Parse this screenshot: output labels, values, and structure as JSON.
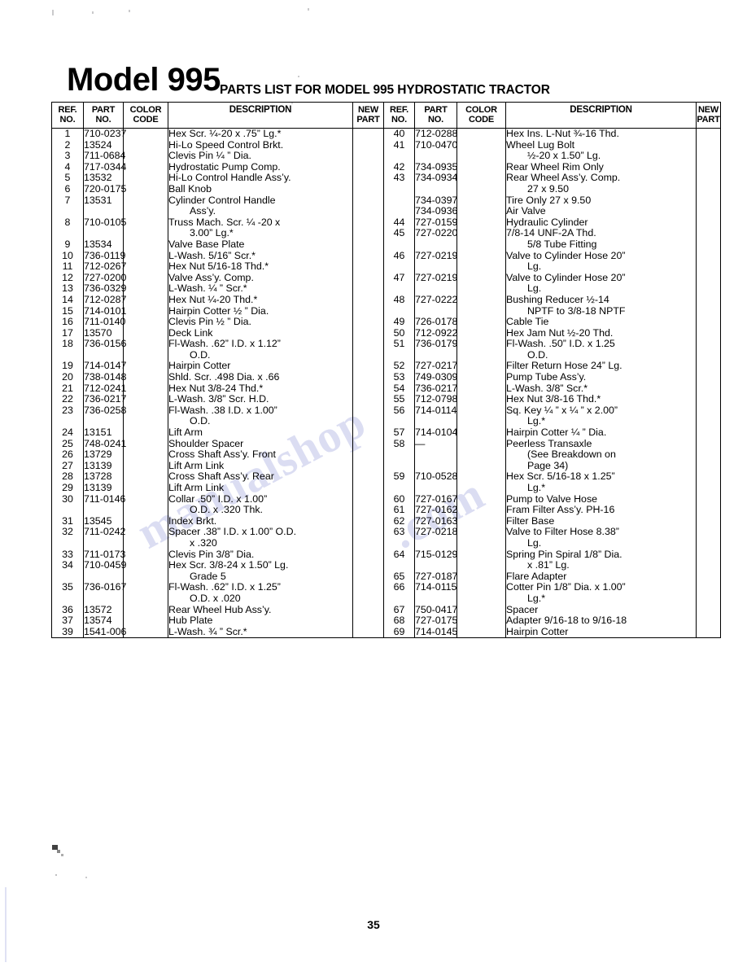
{
  "document": {
    "model_title": "Model 995",
    "parts_list_title": "PARTS LIST FOR MODEL 995 HYDROSTATIC TRACTOR",
    "page_number": "35",
    "watermark_line_1": "manualshop",
    "watermark_line_2": ".com"
  },
  "table": {
    "headers": {
      "ref_no": "REF.\nNO.",
      "ref_no_line1": "REF.",
      "ref_no_line2": "NO.",
      "part_no_line1": "PART",
      "part_no_line2": "NO.",
      "color_code_line1": "COLOR",
      "color_code_line2": "CODE",
      "description": "DESCRIPTION",
      "new_part_line1": "NEW",
      "new_part_line2": "PART"
    },
    "left_rows": [
      {
        "ref": "1",
        "part": "710-0237",
        "color": "",
        "desc": "Hex Scr. ¼-20 x .75” Lg.*",
        "cont": "",
        "new": ""
      },
      {
        "ref": "2",
        "part": "13524",
        "color": "",
        "desc": "Hi-Lo Speed Control Brkt.",
        "cont": "",
        "new": ""
      },
      {
        "ref": "3",
        "part": "711-0684",
        "color": "",
        "desc": "Clevis Pin ¼ ” Dia.",
        "cont": "",
        "new": ""
      },
      {
        "ref": "4",
        "part": "717-0344",
        "color": "",
        "desc": "Hydrostatic Pump Comp.",
        "cont": "",
        "new": ""
      },
      {
        "ref": "5",
        "part": "13532",
        "color": "",
        "desc": "Hi-Lo Control Handle Ass’y.",
        "cont": "",
        "new": ""
      },
      {
        "ref": "6",
        "part": "720-0175",
        "color": "",
        "desc": "Ball Knob",
        "cont": "",
        "new": ""
      },
      {
        "ref": "7",
        "part": "13531",
        "color": "",
        "desc": "Cylinder Control Handle",
        "cont": "Ass’y.",
        "new": ""
      },
      {
        "ref": "8",
        "part": "710-0105",
        "color": "",
        "desc": "Truss Mach. Scr. ¼ -20 x",
        "cont": "3.00” Lg.*",
        "new": ""
      },
      {
        "ref": "9",
        "part": "13534",
        "color": "",
        "desc": "Valve Base Plate",
        "cont": "",
        "new": ""
      },
      {
        "ref": "10",
        "part": "736-0119",
        "color": "",
        "desc": "L-Wash. 5/16” Scr.*",
        "cont": "",
        "new": ""
      },
      {
        "ref": "11",
        "part": "712-0267",
        "color": "",
        "desc": "Hex Nut 5/16-18 Thd.*",
        "cont": "",
        "new": ""
      },
      {
        "ref": "12",
        "part": "727-0200",
        "color": "",
        "desc": "Valve Ass’y. Comp.",
        "cont": "",
        "new": ""
      },
      {
        "ref": "13",
        "part": "736-0329",
        "color": "",
        "desc": "L-Wash. ¼ ” Scr.*",
        "cont": "",
        "new": ""
      },
      {
        "ref": "14",
        "part": "712-0287",
        "color": "",
        "desc": "Hex Nut ¼-20 Thd.*",
        "cont": "",
        "new": ""
      },
      {
        "ref": "15",
        "part": "714-0101",
        "color": "",
        "desc": "Hairpin Cotter ½ ” Dia.",
        "cont": "",
        "new": ""
      },
      {
        "ref": "16",
        "part": "711-0140",
        "color": "",
        "desc": "Clevis Pin ½ ” Dia.",
        "cont": "",
        "new": ""
      },
      {
        "ref": "17",
        "part": "13570",
        "color": "",
        "desc": "Deck Link",
        "cont": "",
        "new": ""
      },
      {
        "ref": "18",
        "part": "736-0156",
        "color": "",
        "desc": "Fl-Wash. .62” I.D. x 1.12”",
        "cont": "O.D.",
        "new": ""
      },
      {
        "ref": "19",
        "part": "714-0147",
        "color": "",
        "desc": "Hairpin Cotter",
        "cont": "",
        "new": ""
      },
      {
        "ref": "20",
        "part": "738-0148",
        "color": "",
        "desc": "Shld. Scr. .498 Dia. x .66",
        "cont": "",
        "new": ""
      },
      {
        "ref": "21",
        "part": "712-0241",
        "color": "",
        "desc": "Hex Nut 3/8-24 Thd.*",
        "cont": "",
        "new": ""
      },
      {
        "ref": "22",
        "part": "736-0217",
        "color": "",
        "desc": "L-Wash. 3/8” Scr. H.D.",
        "cont": "",
        "new": ""
      },
      {
        "ref": "23",
        "part": "736-0258",
        "color": "",
        "desc": "Fl-Wash. .38 I.D. x 1.00”",
        "cont": "O.D.",
        "new": ""
      },
      {
        "ref": "24",
        "part": "13151",
        "color": "",
        "desc": "Lift Arm",
        "cont": "",
        "new": ""
      },
      {
        "ref": "25",
        "part": "748-0241",
        "color": "",
        "desc": "Shoulder Spacer",
        "cont": "",
        "new": ""
      },
      {
        "ref": "26",
        "part": "13729",
        "color": "",
        "desc": "Cross Shaft Ass’y. Front",
        "cont": "",
        "new": ""
      },
      {
        "ref": "27",
        "part": "13139",
        "color": "",
        "desc": "Lift Arm Link",
        "cont": "",
        "new": ""
      },
      {
        "ref": "28",
        "part": "13728",
        "color": "",
        "desc": "Cross Shaft Ass’y. Rear",
        "cont": "",
        "new": ""
      },
      {
        "ref": "29",
        "part": "13139",
        "color": "",
        "desc": "Lift Arm Link",
        "cont": "",
        "new": ""
      },
      {
        "ref": "30",
        "part": "711-0146",
        "color": "",
        "desc": "Collar .50” I.D. x 1.00”",
        "cont": "O.D. x .320 Thk.",
        "new": ""
      },
      {
        "ref": "31",
        "part": "13545",
        "color": "",
        "desc": "Index Brkt.",
        "cont": "",
        "new": ""
      },
      {
        "ref": "32",
        "part": "711-0242",
        "color": "",
        "desc": "Spacer .38” I.D. x 1.00” O.D.",
        "cont": "x .320",
        "new": ""
      },
      {
        "ref": "33",
        "part": "711-0173",
        "color": "",
        "desc": "Clevis Pin 3/8” Dia.",
        "cont": "",
        "new": ""
      },
      {
        "ref": "34",
        "part": "710-0459",
        "color": "",
        "desc": "Hex Scr. 3/8-24 x 1.50” Lg.",
        "cont": "Grade 5",
        "new": ""
      },
      {
        "ref": "35",
        "part": "736-0167",
        "color": "",
        "desc": "Fl-Wash. .62” I.D. x 1.25”",
        "cont": "O.D. x .020",
        "new": ""
      },
      {
        "ref": "36",
        "part": "13572",
        "color": "",
        "desc": "Rear Wheel Hub Ass’y.",
        "cont": "",
        "new": ""
      },
      {
        "ref": "37",
        "part": "13574",
        "color": "",
        "desc": "Hub Plate",
        "cont": "",
        "new": ""
      },
      {
        "ref": "39",
        "part": "1541-006",
        "color": "",
        "desc": "L-Wash. ¾ ” Scr.*",
        "cont": "",
        "new": ""
      }
    ],
    "right_rows": [
      {
        "ref": "40",
        "part": "712-0288",
        "color": "",
        "desc": "Hex Ins. L-Nut ¾-16 Thd.",
        "cont": "",
        "new": ""
      },
      {
        "ref": "41",
        "part": "710-0470",
        "color": "",
        "desc": "Wheel Lug  Bolt",
        "cont": "½-20 x 1.50” Lg.",
        "new": ""
      },
      {
        "ref": "42",
        "part": "734-0935",
        "color": "",
        "desc": "Rear Wheel Rim Only",
        "cont": "",
        "new": ""
      },
      {
        "ref": "43",
        "part": "734-0934",
        "color": "",
        "desc": "Rear Wheel Ass’y. Comp.",
        "cont": "27 x 9.50",
        "new": ""
      },
      {
        "ref": "",
        "part": "734-0397",
        "color": "",
        "desc": "Tire Only 27 x 9.50",
        "cont": "",
        "new": ""
      },
      {
        "ref": "",
        "part": "734-0936",
        "color": "",
        "desc": "Air Valve",
        "cont": "",
        "new": ""
      },
      {
        "ref": "44",
        "part": "727-0159",
        "color": "",
        "desc": "Hydraulic Cylinder",
        "cont": "",
        "new": ""
      },
      {
        "ref": "45",
        "part": "727-0220",
        "color": "",
        "desc": "7/8-14 UNF-2A Thd.",
        "cont": "5/8 Tube Fitting",
        "new": ""
      },
      {
        "ref": "46",
        "part": "727-0219",
        "color": "",
        "desc": "Valve to Cylinder Hose 20”",
        "cont": "Lg.",
        "new": ""
      },
      {
        "ref": "47",
        "part": "727-0219",
        "color": "",
        "desc": "Valve to Cylinder Hose 20”",
        "cont": "Lg.",
        "new": ""
      },
      {
        "ref": "48",
        "part": "727-0222",
        "color": "",
        "desc": "Bushing Reducer ½-14",
        "cont": "NPTF to 3/8-18 NPTF",
        "new": ""
      },
      {
        "ref": "49",
        "part": "726-0178",
        "color": "",
        "desc": "Cable Tie",
        "cont": "",
        "new": ""
      },
      {
        "ref": "50",
        "part": "712-0922",
        "color": "",
        "desc": "Hex Jam Nut ½-20 Thd.",
        "cont": "",
        "new": ""
      },
      {
        "ref": "51",
        "part": "736-0179",
        "color": "",
        "desc": "Fl-Wash. .50” I.D. x 1.25",
        "cont": "O.D.",
        "new": ""
      },
      {
        "ref": "52",
        "part": "727-0217",
        "color": "",
        "desc": "Filter Return Hose 24” Lg.",
        "cont": "",
        "new": ""
      },
      {
        "ref": "53",
        "part": "749-0309",
        "color": "",
        "desc": "Pump Tube Ass’y.",
        "cont": "",
        "new": ""
      },
      {
        "ref": "54",
        "part": "736-0217",
        "color": "",
        "desc": "L-Wash. 3/8” Scr.*",
        "cont": "",
        "new": ""
      },
      {
        "ref": "55",
        "part": "712-0798",
        "color": "",
        "desc": "Hex Nut 3/8-16 Thd.*",
        "cont": "",
        "new": ""
      },
      {
        "ref": "56",
        "part": "714-0114",
        "color": "",
        "desc": "Sq. Key ¼ ” x ¼ ” x 2.00”",
        "cont": "Lg.*",
        "new": ""
      },
      {
        "ref": "57",
        "part": "714-0104",
        "color": "",
        "desc": "Hairpin Cotter ¼ ” Dia.",
        "cont": "",
        "new": ""
      },
      {
        "ref": "58",
        "part": "—",
        "color": "",
        "desc": "Peerless Transaxle",
        "cont": "(See Breakdown on",
        "cont2": "Page 34)",
        "new": ""
      },
      {
        "ref": "59",
        "part": "710-0528",
        "color": "",
        "desc": "Hex Scr. 5/16-18 x 1.25”",
        "cont": "Lg.*",
        "new": ""
      },
      {
        "ref": "60",
        "part": "727-0167",
        "color": "",
        "desc": "Pump to Valve Hose",
        "cont": "",
        "new": ""
      },
      {
        "ref": "61",
        "part": "727-0162",
        "color": "",
        "desc": "Fram Filter Ass’y. PH-16",
        "cont": "",
        "new": ""
      },
      {
        "ref": "62",
        "part": "727-0163",
        "color": "",
        "desc": "Filter Base",
        "cont": "",
        "new": ""
      },
      {
        "ref": "63",
        "part": "727-0218",
        "color": "",
        "desc": "Valve to Filter Hose 8.38”",
        "cont": "Lg.",
        "new": ""
      },
      {
        "ref": "64",
        "part": "715-0129",
        "color": "",
        "desc": "Spring Pin Spiral 1/8” Dia.",
        "cont": "x .81” Lg.",
        "new": ""
      },
      {
        "ref": "65",
        "part": "727-0187",
        "color": "",
        "desc": "Flare Adapter",
        "cont": "",
        "new": ""
      },
      {
        "ref": "66",
        "part": "714-0115",
        "color": "",
        "desc": "Cotter Pin 1/8” Dia. x 1.00”",
        "cont": "Lg.*",
        "new": ""
      },
      {
        "ref": "67",
        "part": "750-0417",
        "color": "",
        "desc": "Spacer",
        "cont": "",
        "new": ""
      },
      {
        "ref": "68",
        "part": "727-0175",
        "color": "",
        "desc": "Adapter 9/16-18 to 9/16-18",
        "cont": "",
        "new": ""
      },
      {
        "ref": "69",
        "part": "714-0145",
        "color": "",
        "desc": "Hairpin Cotter",
        "cont": "",
        "new": ""
      }
    ]
  }
}
